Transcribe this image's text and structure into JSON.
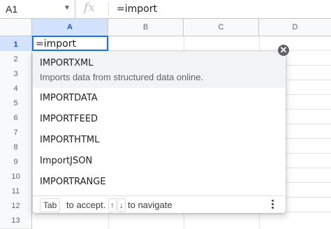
{
  "formula_bar": {
    "name_box": "A1",
    "fx_icon": "fx-icon",
    "formula": "=import"
  },
  "grid": {
    "columns": [
      "A",
      "B",
      "C",
      "D"
    ],
    "rows": [
      "1",
      "2",
      "3",
      "4",
      "5",
      "6",
      "7",
      "8",
      "9",
      "10",
      "11",
      "12",
      "13"
    ],
    "active_cell_value": "=import"
  },
  "autocomplete": {
    "items": [
      {
        "name": "IMPORTXML",
        "description": "Imports data from structured data online."
      },
      {
        "name": "IMPORTDATA"
      },
      {
        "name": "IMPORTFEED"
      },
      {
        "name": "IMPORTHTML"
      },
      {
        "name": "ImportJSON"
      },
      {
        "name": "IMPORTRANGE"
      }
    ],
    "footer": {
      "tab_key": "Tab",
      "accept_text": "to accept.",
      "up_key": "↑",
      "down_key": "↓",
      "navigate_text": "to navigate"
    },
    "close_icon": "close-icon",
    "more_icon": "more-vert-icon"
  },
  "colors": {
    "accent": "#1a73e8",
    "selected_header": "#d3e3fd",
    "highlight_row": "#f1f3f4"
  }
}
